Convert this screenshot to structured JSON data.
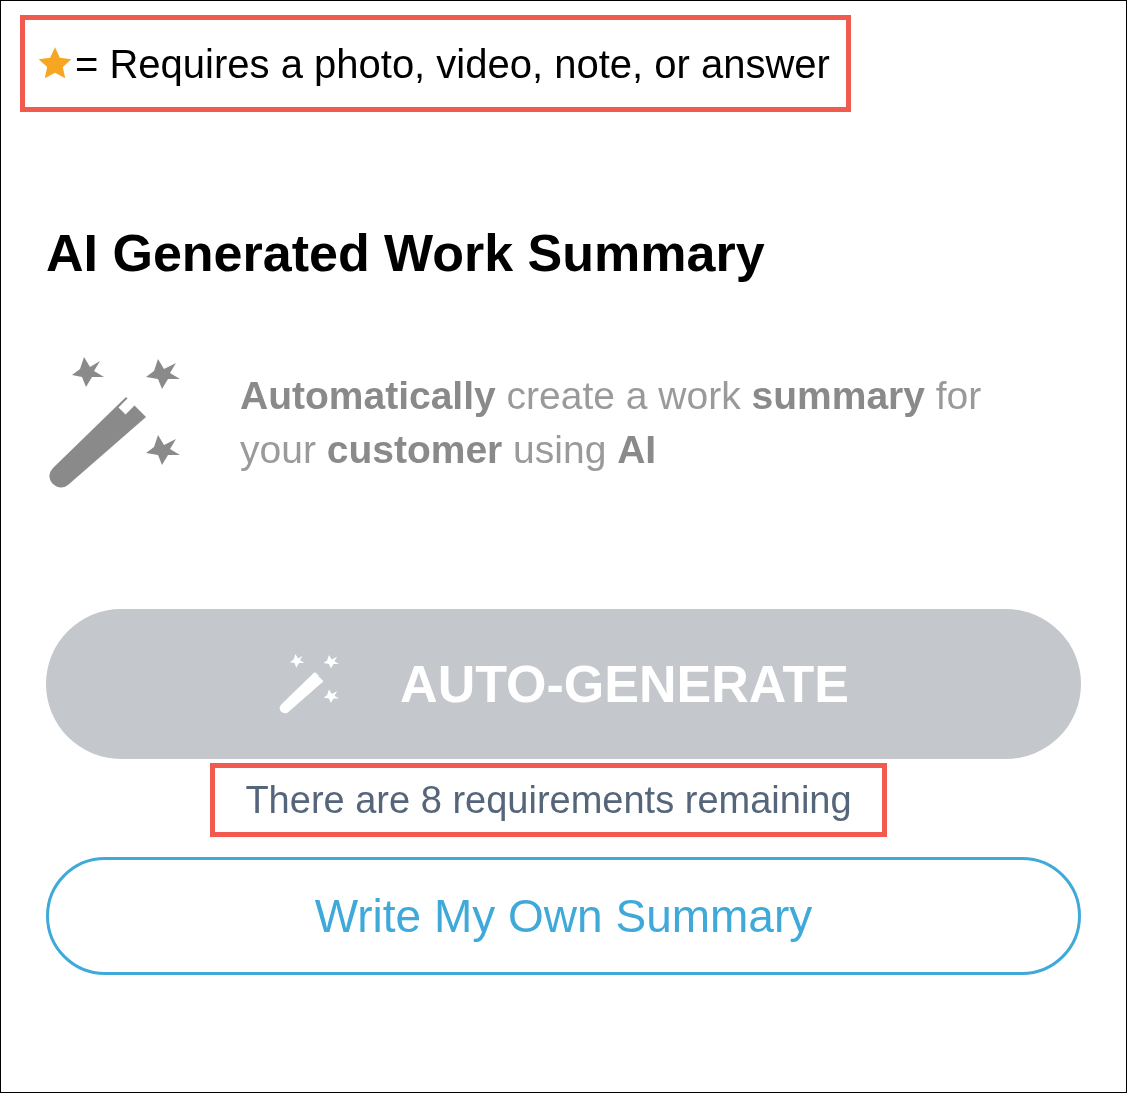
{
  "legend": {
    "text": "= Requires a photo, video, note, or answer",
    "highlighted": true
  },
  "title": "AI Generated Work Summary",
  "description": "**Automatically** create a work **summary** for your **customer** using **AI**",
  "generate_button": {
    "label": "AUTO-GENERATE",
    "disabled": true
  },
  "requirements_note": {
    "text": "There are 8 requirements remaining",
    "highlighted": true
  },
  "write_button": {
    "label": "Write My Own Summary"
  }
}
